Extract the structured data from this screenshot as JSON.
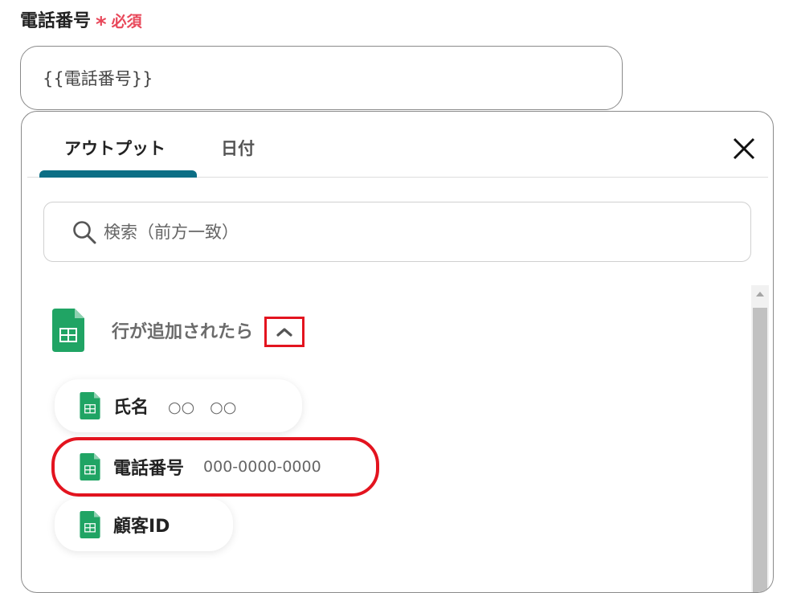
{
  "field": {
    "label": "電話番号",
    "asterisk": "*",
    "required": "必須",
    "value": "{{電話番号}}"
  },
  "popup": {
    "tabs": [
      {
        "label": "アウトプット",
        "active": true
      },
      {
        "label": "日付",
        "active": false
      }
    ],
    "close_icon": "close-icon",
    "search": {
      "placeholder": "検索（前方一致）",
      "icon": "search-icon"
    },
    "group": {
      "title": "行が追加されたら",
      "icon": "google-sheets-icon",
      "toggle_icon": "chevron-up-icon",
      "items": [
        {
          "label": "氏名",
          "value": "○○　○○"
        },
        {
          "label": "電話番号",
          "value": "000-0000-0000"
        },
        {
          "label": "顧客ID",
          "value": ""
        }
      ]
    }
  },
  "colors": {
    "accent": "#0b6e85",
    "required": "#e8485a",
    "highlight": "#e3141f",
    "sheets_green": "#20a464"
  }
}
